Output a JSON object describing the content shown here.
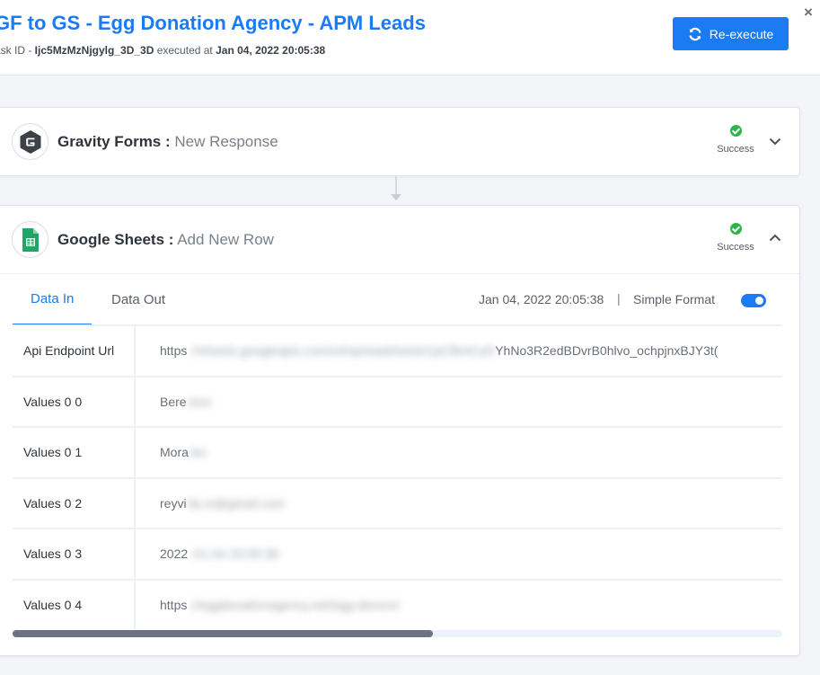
{
  "header": {
    "title": "GF to GS - Egg Donation Agency - APM Leads",
    "task_id_prefix": "ask ID - ",
    "task_id": "Ijc5MzMzNjgylg_3D_3D",
    "executed_at_label": " executed at ",
    "executed_at": "Jan 04, 2022 20:05:38",
    "reexecute_label": "Re-execute",
    "close_glyph": "×"
  },
  "steps": [
    {
      "app": "Gravity Forms :",
      "event": "New Response",
      "status": "Success",
      "expanded": false,
      "icon": "gravity-forms-logo"
    },
    {
      "app": "Google Sheets :",
      "event": "Add New Row",
      "status": "Success",
      "expanded": true,
      "icon": "google-sheets-logo"
    }
  ],
  "detail": {
    "tabs": [
      {
        "label": "Data In",
        "active": true
      },
      {
        "label": "Data Out",
        "active": false
      }
    ],
    "execution_time": "Jan 04, 2022 20:05:38",
    "separator": "|",
    "format_label": "Simple Format",
    "simple_format_on": true,
    "rows": [
      {
        "key": "Api Endpoint Url",
        "visible": "https",
        "blurred": "://sheets.googleapis.com/v4/spreadsheets/1pCfkmCyD",
        "tail": "YhNo3R2edBDvrB0hlvo_ochpjnxBJY3t("
      },
      {
        "key": "Values 0 0",
        "visible": "Bere",
        "blurred": "nice",
        "tail": ""
      },
      {
        "key": "Values 0 1",
        "visible": "Mora",
        "blurred": "les",
        "tail": ""
      },
      {
        "key": "Values 0 2",
        "visible": "reyvi",
        "blurred": "lla.m@gmail.com",
        "tail": ""
      },
      {
        "key": "Values 0 3",
        "visible": "2022",
        "blurred": "-01-04 20:05:38",
        "tail": ""
      },
      {
        "key": "Values 0 4",
        "visible": "https",
        "blurred": "://eggdonationagency.net/egg-donors/",
        "tail": ""
      }
    ]
  },
  "colors": {
    "accent": "#1a7bf2",
    "success": "#2eb54a"
  }
}
